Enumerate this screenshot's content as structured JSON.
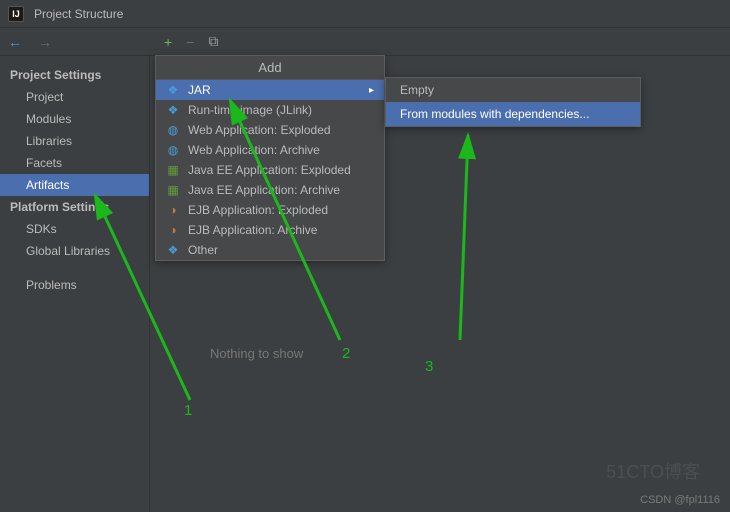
{
  "window": {
    "title": "Project Structure"
  },
  "toolbar": {
    "back": "←",
    "forward": "→",
    "plus": "+",
    "minus": "−",
    "copy": "⧉"
  },
  "sidebar": {
    "section1": {
      "heading": "Project Settings",
      "items": [
        "Project",
        "Modules",
        "Libraries",
        "Facets",
        "Artifacts"
      ]
    },
    "section2": {
      "heading": "Platform Settings",
      "items": [
        "SDKs",
        "Global Libraries"
      ]
    },
    "section3": {
      "items": [
        "Problems"
      ]
    }
  },
  "content": {
    "empty": "Nothing to show"
  },
  "add_menu": {
    "title": "Add",
    "items": [
      {
        "icon": "❖",
        "iconClass": "icon-blue",
        "label": "JAR",
        "sub": true
      },
      {
        "icon": "❖",
        "iconClass": "icon-blue",
        "label": "Run-time image (JLink)"
      },
      {
        "icon": "◍",
        "iconClass": "icon-blue",
        "label": "Web Application: Exploded"
      },
      {
        "icon": "◍",
        "iconClass": "icon-blue",
        "label": "Web Application: Archive"
      },
      {
        "icon": "▦",
        "iconClass": "icon-green",
        "label": "Java EE Application: Exploded"
      },
      {
        "icon": "▦",
        "iconClass": "icon-green",
        "label": "Java EE Application: Archive"
      },
      {
        "icon": "◑",
        "iconClass": "icon-brown",
        "label": "EJB Application: Exploded"
      },
      {
        "icon": "◑",
        "iconClass": "icon-brown",
        "label": "EJB Application: Archive"
      },
      {
        "icon": "❖",
        "iconClass": "icon-blue",
        "label": "Other"
      }
    ]
  },
  "sub_menu": {
    "items": [
      "Empty",
      "From modules with dependencies..."
    ]
  },
  "annotations": {
    "n1": "1",
    "n2": "2",
    "n3": "3"
  },
  "watermark": {
    "corner": "51CTO博客",
    "footer": "CSDN @fpl1116"
  }
}
